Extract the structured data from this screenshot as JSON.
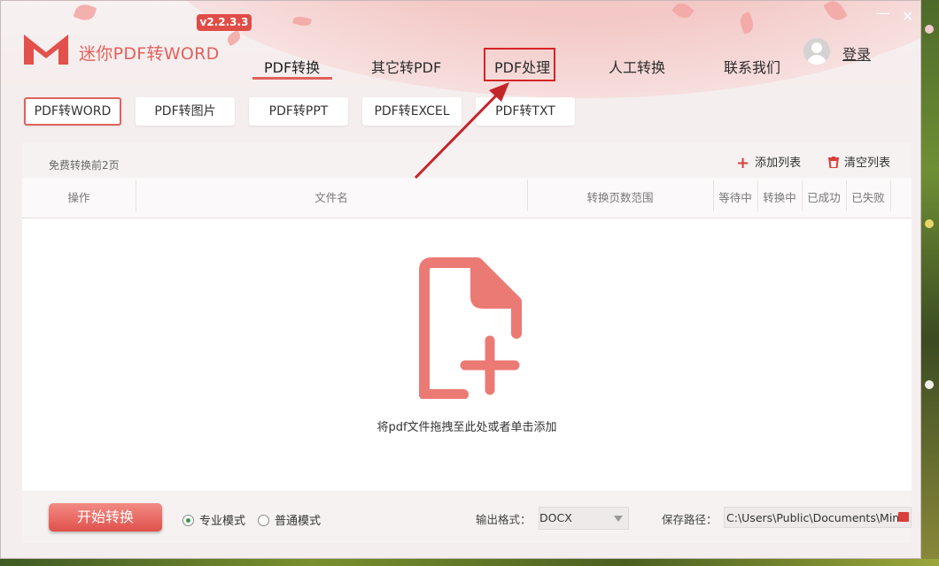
{
  "app": {
    "title": "迷你PDF转WORD",
    "version": "v2.2.3.3",
    "login_label": "登录",
    "minimize_glyph": "—",
    "close_glyph": "✕"
  },
  "nav": [
    {
      "label": "PDF转换",
      "active": true
    },
    {
      "label": "其它转PDF",
      "active": false
    },
    {
      "label": "PDF处理",
      "active": false,
      "highlighted": true
    },
    {
      "label": "人工转换",
      "active": false
    },
    {
      "label": "联系我们",
      "active": false
    }
  ],
  "subtabs": [
    {
      "label": "PDF转WORD",
      "active": true
    },
    {
      "label": "PDF转图片",
      "active": false
    },
    {
      "label": "PDF转PPT",
      "active": false
    },
    {
      "label": "PDF转EXCEL",
      "active": false
    },
    {
      "label": "PDF转TXT",
      "active": false
    }
  ],
  "panel": {
    "free_note": "免费转换前2页",
    "add_list": "添加列表",
    "clear_list": "清空列表",
    "columns": [
      "操作",
      "文件名",
      "转换页数范围",
      "等待中",
      "转换中",
      "已成功",
      "已失败"
    ],
    "drop_hint": "将pdf文件拖拽至此处或者单击添加"
  },
  "footer": {
    "start_button": "开始转换",
    "mode_pro": "专业模式",
    "mode_normal": "普通模式",
    "selected_mode": "专业模式",
    "output_format_label": "输出格式：",
    "output_format_value": "DOCX",
    "save_path_label": "保存路径：",
    "save_path_value": "C:\\Users\\Public\\Documents\\Mini"
  },
  "colors": {
    "accent": "#e0625d",
    "highlight_red": "#d42525",
    "brand_text": "#e2615c"
  },
  "icons": {
    "add": "plus-icon",
    "clear": "trash-icon",
    "file_add": "file-add-icon",
    "folder": "folder-icon"
  }
}
